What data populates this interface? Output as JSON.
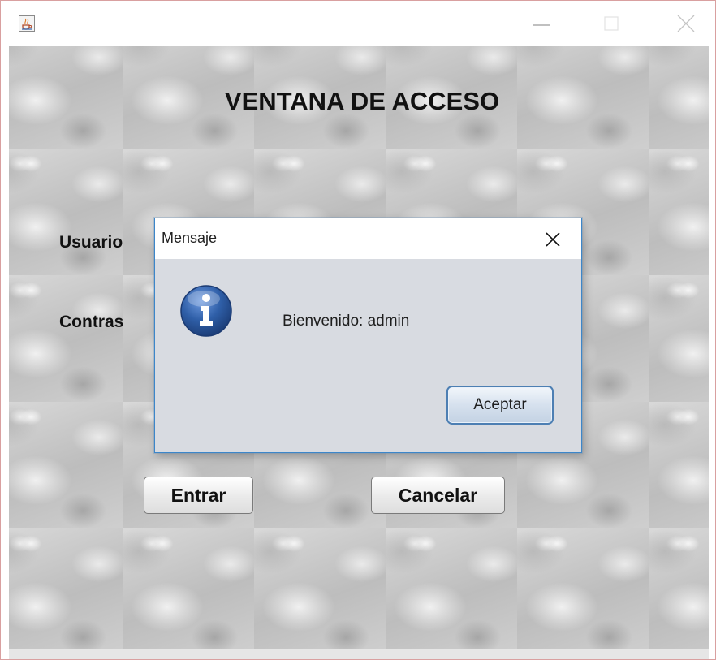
{
  "window": {
    "icon": "java-cup-icon",
    "controls": {
      "minimize": "minimize-icon",
      "maximize": "maximize-icon",
      "close": "close-icon"
    }
  },
  "form": {
    "title": "VENTANA DE ACCESO",
    "user_label": "Usuario",
    "password_label": "Contras",
    "enter_button": "Entrar",
    "cancel_button": "Cancelar",
    "background": "metallic-bubble-texture"
  },
  "dialog": {
    "title": "Mensaje",
    "message": "Bienvenido: admin",
    "ok_button": "Aceptar",
    "icon": "info-icon",
    "close_icon": "close-icon"
  },
  "colors": {
    "dialog_border": "#3c86c9",
    "dialog_body": "#d8dbe1",
    "info_icon_blue": "#2f5fa8",
    "button_focus_border": "#4d7fb3"
  }
}
